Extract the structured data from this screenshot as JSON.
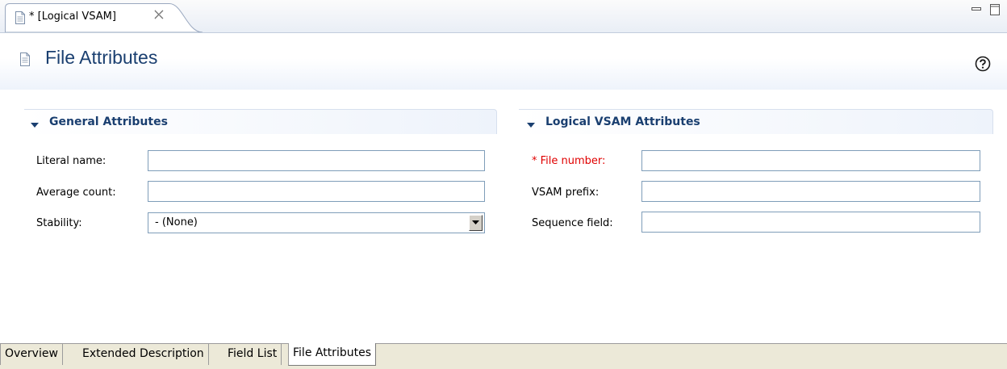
{
  "editor_tab": {
    "title": "* [Logical VSAM]",
    "icon": "document-icon",
    "close_icon": "close-icon"
  },
  "window_controls": {
    "minimize_icon": "minimize-icon",
    "maximize_icon": "maximize-icon"
  },
  "header": {
    "icon": "document-icon",
    "title": "File Attributes",
    "help_icon": "help-icon"
  },
  "general_section": {
    "title": "General Attributes",
    "fields": {
      "literal_name": {
        "label": "Literal name:",
        "value": ""
      },
      "average_count": {
        "label": "Average count:",
        "value": ""
      },
      "stability": {
        "label": "Stability:",
        "value": "- (None)"
      }
    }
  },
  "logical_vsam_section": {
    "title": "Logical VSAM Attributes",
    "fields": {
      "file_number": {
        "label": "* File number:",
        "value": "",
        "required": true
      },
      "vsam_prefix": {
        "label": "VSAM prefix:",
        "value": ""
      },
      "sequence_field": {
        "label": "Sequence field:",
        "value": ""
      }
    }
  },
  "bottom_tabs": {
    "overview": "Overview",
    "extended_description": "Extended Description",
    "field_list": "Field List",
    "file_attributes": "File Attributes",
    "active": "File Attributes"
  },
  "colors": {
    "title_blue": "#1a3f70",
    "required_red": "#e00000",
    "input_border": "#7f9db9"
  }
}
